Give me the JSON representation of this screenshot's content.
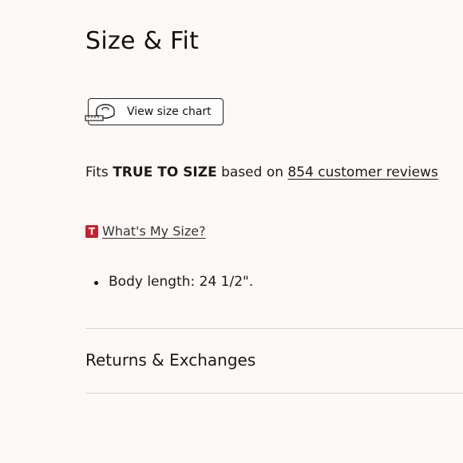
{
  "section": {
    "title": "Size & Fit"
  },
  "size_chart": {
    "button_label": "View size chart",
    "icon": "tape-measure-icon"
  },
  "fit": {
    "prefix": "Fits",
    "rating": "TRUE TO SIZE",
    "middle": "based on",
    "reviews_link": "854 customer reviews"
  },
  "whats_my_size": {
    "icon_letter": "T",
    "icon_color": "#c8232c",
    "link_label": "What's My Size?"
  },
  "specs": [
    {
      "text": "Body length: 24 1/2\"."
    }
  ],
  "accordion": {
    "returns_label": "Returns & Exchanges"
  }
}
